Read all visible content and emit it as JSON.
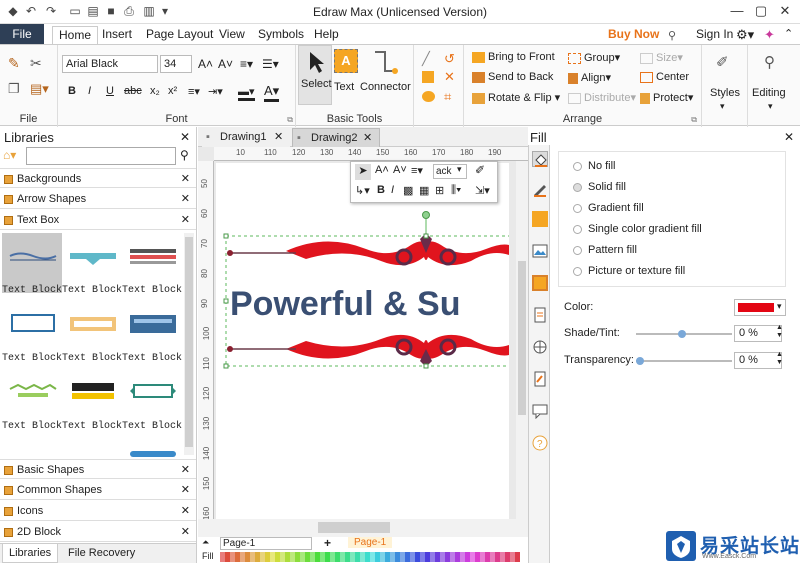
{
  "window": {
    "title": "Edraw Max (Unlicensed Version)"
  },
  "menu": {
    "file": "File",
    "tabs": [
      "Home",
      "Insert",
      "Page Layout",
      "View",
      "Symbols",
      "Help"
    ],
    "buy_now": "Buy Now",
    "sign_in": "Sign In"
  },
  "ribbon": {
    "file_group": {
      "label": "File"
    },
    "font_group": {
      "label": "Font",
      "font_name": "Arial Black",
      "font_size": "34"
    },
    "basic_tools": {
      "label": "Basic Tools",
      "select": "Select",
      "text": "Text",
      "connector": "Connector"
    },
    "arrange": {
      "label": "Arrange",
      "bring_to_front": "Bring to Front",
      "send_to_back": "Send to Back",
      "rotate_flip": "Rotate & Flip",
      "group": "Group",
      "align": "Align",
      "distribute": "Distribute",
      "size": "Size",
      "center": "Center",
      "protect": "Protect"
    },
    "styles": "Styles",
    "editing": "Editing"
  },
  "libraries": {
    "title": "Libraries",
    "search_placeholder": "",
    "categories_top": [
      "Backgrounds",
      "Arrow Shapes",
      "Text Box"
    ],
    "text_block_label": "Text Block",
    "categories_bottom": [
      "Basic Shapes",
      "Common Shapes",
      "Icons",
      "2D Block"
    ],
    "bottom_tabs": [
      "Libraries",
      "File Recovery"
    ]
  },
  "documents": {
    "tabs": [
      "Drawing1",
      "Drawing2"
    ]
  },
  "ruler": {
    "h_ticks": [
      "10",
      "110",
      "120",
      "130",
      "140",
      "150",
      "160",
      "170",
      "180",
      "190"
    ],
    "v_ticks": [
      "50",
      "60",
      "70",
      "80",
      "90",
      "100",
      "110",
      "120",
      "130",
      "140",
      "150",
      "160"
    ]
  },
  "canvas": {
    "text": "Powerful & Su",
    "font_box_value": "ack"
  },
  "pages": {
    "current": "Page-1",
    "tab": "Page-1",
    "fill_label": "Fill"
  },
  "fill_panel": {
    "title": "Fill",
    "options": [
      "No fill",
      "Solid fill",
      "Gradient fill",
      "Single color gradient fill",
      "Pattern fill",
      "Picture or texture fill"
    ],
    "selected_option": "Solid fill",
    "color_label": "Color:",
    "color_value": "#e30613",
    "shade_label": "Shade/Tint:",
    "shade_value": "0 %",
    "transparency_label": "Transparency:",
    "transparency_value": "0 %"
  },
  "watermark": {
    "text_main": "易采站长站",
    "text_sub": "Www.Easck.Com"
  }
}
